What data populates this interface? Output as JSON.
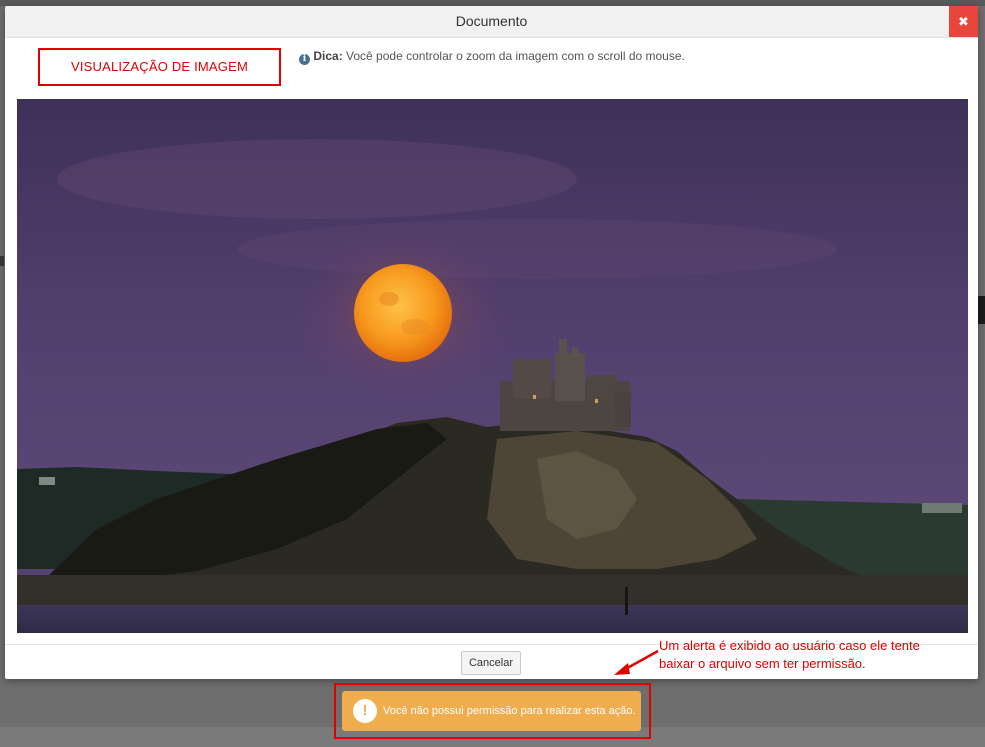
{
  "modal": {
    "title": "Documento",
    "close_symbol": "✖",
    "close_icon": "close-icon",
    "label_box": "VISUALIZAÇÃO DE IMAGEM",
    "tip_icon": "info-circle-icon",
    "tip_icon_glyph": "i",
    "tip_label": "Dica:",
    "tip_text": " Você pode controlar o zoom da imagem com o scroll do mouse.",
    "cancel_label": "Cancelar"
  },
  "annotation": {
    "line1": "Um alerta é exibido ao usuário caso ele tente",
    "line2": "baixar o arquivo sem ter permissão."
  },
  "alert": {
    "icon_glyph": "!",
    "icon": "exclamation-circle-icon",
    "message": "Você não possui permissão para realizar esta ação.",
    "color": "#f0ad4e"
  },
  "colors": {
    "annotation_red": "#e00000",
    "close_button": "#e8463d"
  }
}
